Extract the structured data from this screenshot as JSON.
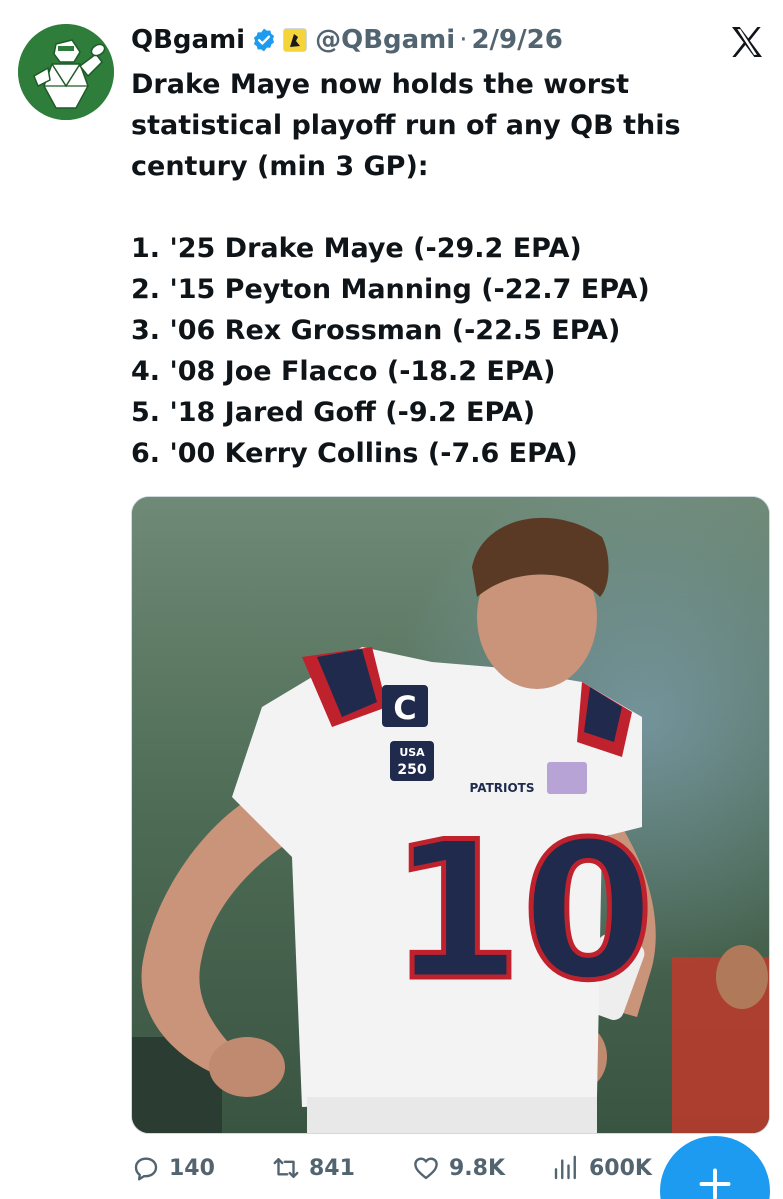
{
  "author": {
    "display_name": "QBgami",
    "handle": "@QBgami",
    "separator": "·",
    "date": "2/9/26",
    "avatar_icon": "qbgami-logo-icon",
    "avatar_color": "#2f7d3a",
    "verified_color": "#1d9bf0"
  },
  "platform": {
    "logo_icon": "x-logo-icon"
  },
  "tweet": {
    "text_lines": [
      "Drake Maye now holds the worst",
      "statistical playoff run of any QB this",
      "century (min 3 GP):"
    ],
    "list": [
      "1. '25 Drake Maye (-29.2 EPA)",
      "2. '15 Peyton Manning (-22.7 EPA)",
      "3. '06 Rex Grossman (-22.5 EPA)",
      "4. '08 Joe Flacco (-18.2 EPA)",
      "5. '18 Jared Goff (-9.2 EPA)",
      "6. '00 Kerry Collins (-7.6 EPA)"
    ]
  },
  "media": {
    "jersey_number": "10",
    "captain_patch": "C",
    "patch_line1": "USA",
    "patch_line2": "250",
    "chest_text": "PATRIOTS"
  },
  "actions": {
    "replies": "140",
    "reposts": "841",
    "likes": "9.8K",
    "views": "600K"
  },
  "fab": {
    "icon": "plus-icon",
    "color": "#1d9bf0"
  }
}
